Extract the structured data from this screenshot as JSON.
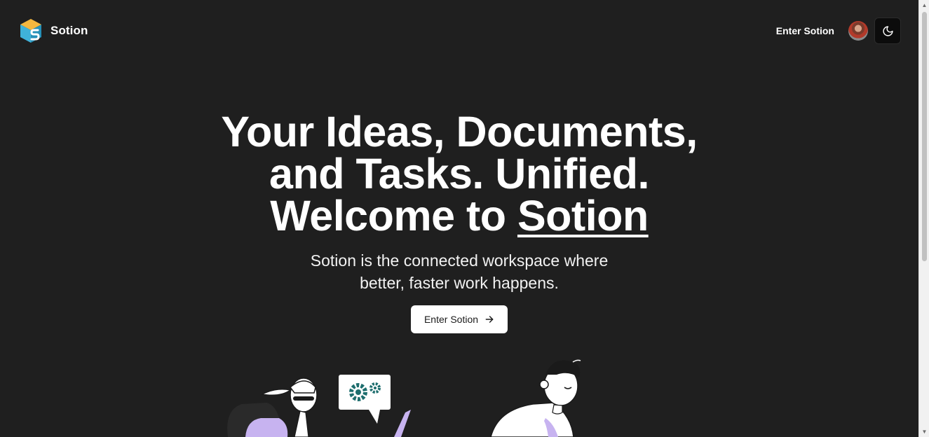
{
  "header": {
    "brand": "Sotion",
    "nav_link": "Enter Sotion",
    "logo_icon": "sotion-cube-logo",
    "theme_icon": "moon-icon"
  },
  "hero": {
    "title_line1": "Your Ideas, Documents,",
    "title_line2": "and Tasks. Unified.",
    "title_line3_prefix": "Welcome to ",
    "title_line3_brand": "Sotion",
    "subtitle_line1": "Sotion is the connected workspace where",
    "subtitle_line2": "better, faster work happens.",
    "cta_label": "Enter Sotion",
    "cta_icon": "arrow-right-icon"
  },
  "colors": {
    "background": "#1f1f1f",
    "text": "#ffffff",
    "button_bg": "#ffffff",
    "illustration_accent": "#c7b3f0",
    "gear_color": "#1e6e6e"
  }
}
